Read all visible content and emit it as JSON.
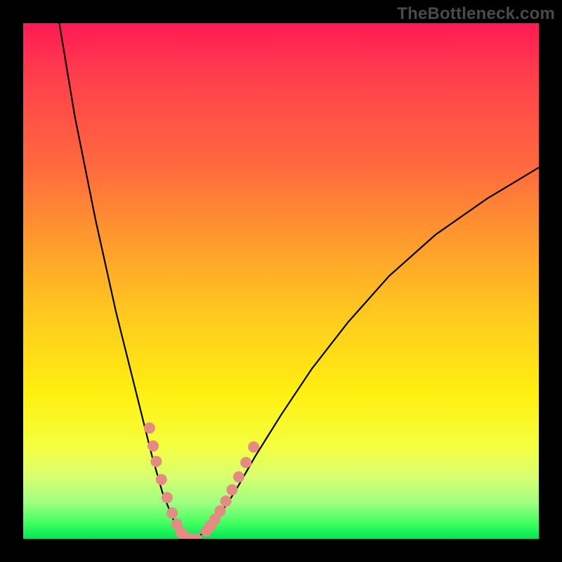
{
  "watermark": "TheBottleneck.com",
  "chart_data": {
    "type": "line",
    "title": "",
    "xlabel": "",
    "ylabel": "",
    "xlim": [
      0,
      100
    ],
    "ylim": [
      0,
      100
    ],
    "grid": false,
    "series": [
      {
        "name": "bottleneck-curve",
        "kind": "curve",
        "color": "#000000",
        "x": [
          7,
          10,
          14,
          18,
          22,
          25,
          27,
          29,
          30,
          31,
          32,
          33,
          34,
          36,
          38,
          41,
          45,
          50,
          56,
          63,
          71,
          80,
          90,
          100
        ],
        "y": [
          100,
          82,
          62,
          44,
          28,
          16,
          9,
          4,
          1.5,
          0.5,
          0,
          0,
          0.5,
          1.8,
          4.5,
          9,
          16,
          24,
          33,
          42,
          51,
          59,
          66,
          72
        ]
      },
      {
        "name": "left-cluster",
        "kind": "points",
        "color": "#e68a84",
        "x": [
          24.5,
          25.2,
          25.8,
          26.8,
          27.9,
          28.9,
          29.8,
          30.6,
          31.4
        ],
        "y": [
          21.5,
          18.0,
          15.0,
          11.5,
          8.0,
          5.0,
          2.8,
          1.2,
          0.4
        ]
      },
      {
        "name": "valley-cluster",
        "kind": "points",
        "color": "#e68a84",
        "x": [
          32.0,
          32.8,
          33.6
        ],
        "y": [
          0.0,
          0.0,
          0.0
        ]
      },
      {
        "name": "right-cluster",
        "kind": "points",
        "color": "#e68a84",
        "x": [
          35.5,
          36.3,
          37.2,
          38.2,
          39.3,
          40.5,
          41.8,
          43.2,
          44.7
        ],
        "y": [
          1.5,
          2.5,
          3.8,
          5.4,
          7.3,
          9.5,
          12.0,
          14.8,
          17.8
        ]
      }
    ]
  }
}
